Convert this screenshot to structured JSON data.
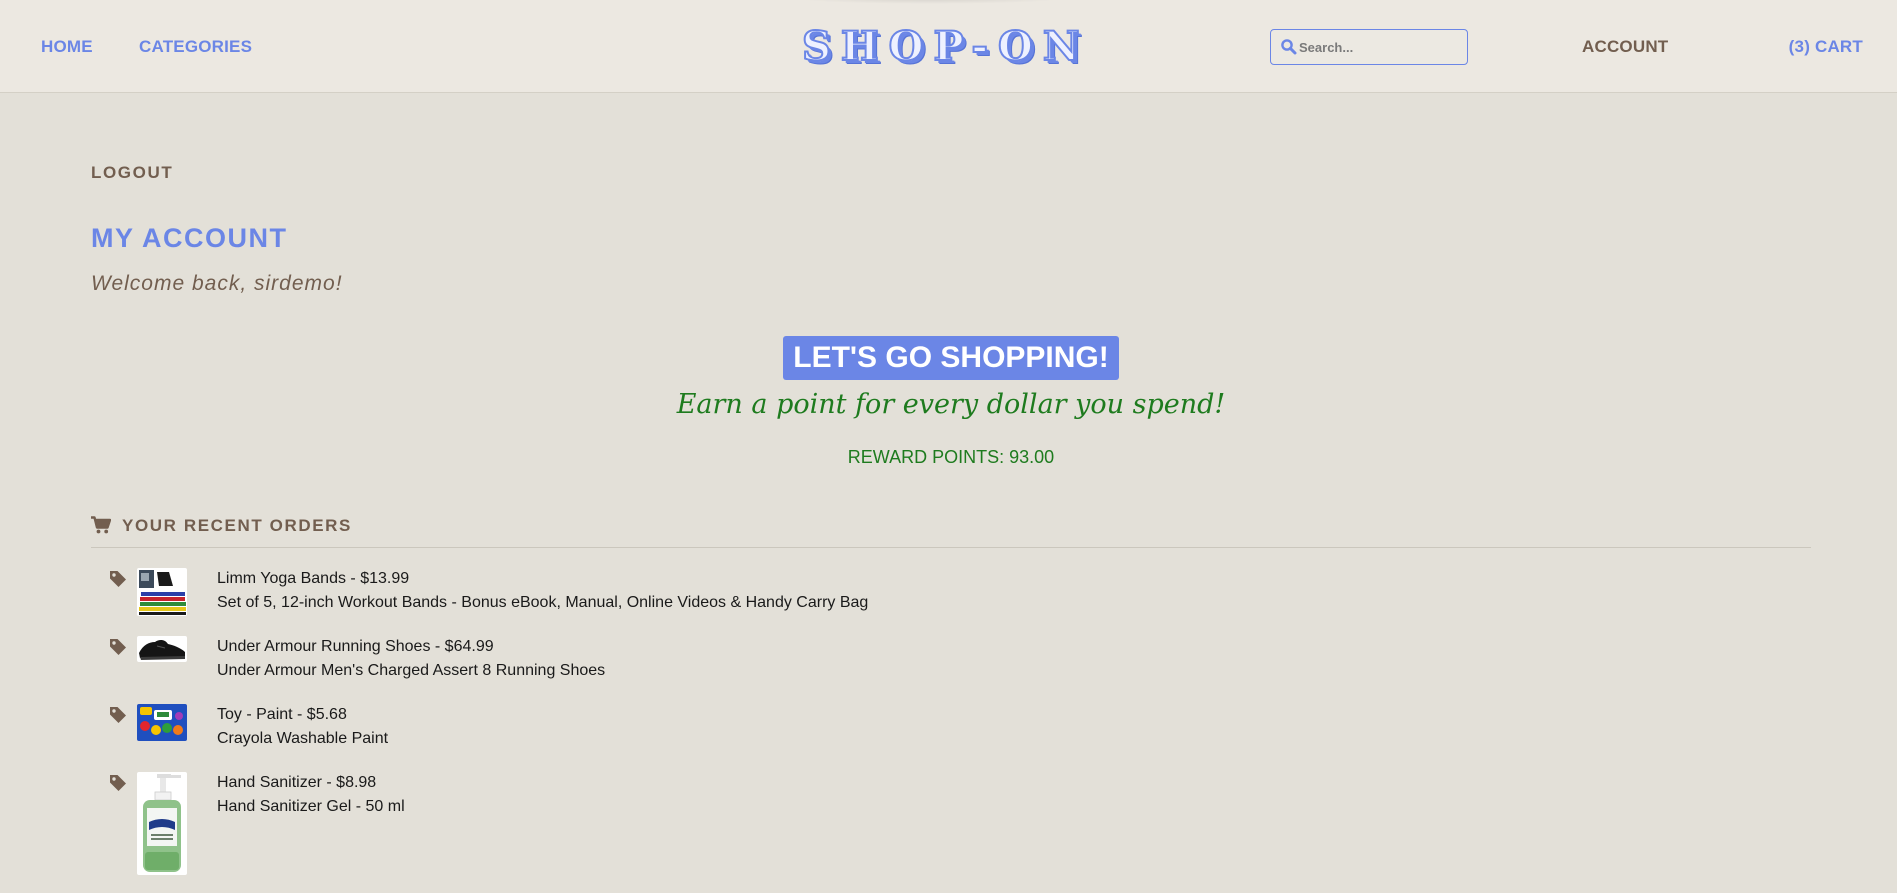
{
  "nav": {
    "home": "HOME",
    "categories": "CATEGORIES",
    "logo": "SHOP-ON",
    "search_placeholder": "Search...",
    "account": "ACCOUNT",
    "cart": "(3) CART"
  },
  "account": {
    "logout": "LOGOUT",
    "title": "MY ACCOUNT",
    "welcome": "Welcome back, sirdemo!"
  },
  "promo": {
    "banner": "LET'S GO SHOPPING!",
    "tagline": "Earn a point for every dollar you spend!",
    "reward_points": "REWARD POINTS: 93.00"
  },
  "orders": {
    "heading": "YOUR RECENT ORDERS",
    "items": [
      {
        "title": "Limm Yoga Bands - $13.99",
        "description": "Set of 5, 12-inch Workout Bands - Bonus eBook, Manual, Online Videos & Handy Carry Bag",
        "icon": "yoga-bands-thumbnail"
      },
      {
        "title": "Under Armour Running Shoes - $64.99",
        "description": "Under Armour Men's Charged Assert 8 Running Shoes",
        "icon": "running-shoes-thumbnail"
      },
      {
        "title": "Toy - Paint - $5.68",
        "description": "Crayola Washable Paint",
        "icon": "paint-set-thumbnail"
      },
      {
        "title": "Hand Sanitizer - $8.98",
        "description": "Hand Sanitizer Gel - 50 ml",
        "icon": "hand-sanitizer-thumbnail"
      }
    ]
  },
  "colors": {
    "accent": "#6b86e6",
    "brown": "#725e4f",
    "green": "#1e7b1e",
    "background": "#e3e0d8",
    "header": "#ece8e1"
  }
}
